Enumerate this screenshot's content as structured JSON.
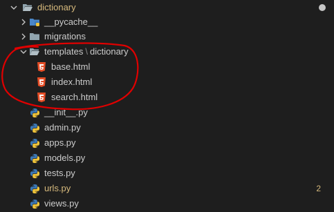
{
  "explorer": {
    "root": {
      "label": "dictionary",
      "icon": "folder-open-icon",
      "expanded": true
    },
    "items": [
      {
        "label": "__pycache__",
        "icon": "folder-python-icon",
        "expanded": false
      },
      {
        "label": "migrations",
        "icon": "folder-icon",
        "expanded": false
      },
      {
        "label_part1": "templates",
        "separator": "\\",
        "label_part2": "dictionary",
        "icon": "folder-open-icon",
        "expanded": true
      },
      {
        "label": "base.html",
        "icon": "html5-icon"
      },
      {
        "label": "index.html",
        "icon": "html5-icon"
      },
      {
        "label": "search.html",
        "icon": "html5-icon"
      },
      {
        "label": "__init__.py",
        "icon": "python-icon"
      },
      {
        "label": "admin.py",
        "icon": "python-icon"
      },
      {
        "label": "apps.py",
        "icon": "python-icon"
      },
      {
        "label": "models.py",
        "icon": "python-icon"
      },
      {
        "label": "tests.py",
        "icon": "python-icon"
      },
      {
        "label": "urls.py",
        "icon": "python-icon",
        "badge": "2"
      },
      {
        "label": "views.py",
        "icon": "python-icon"
      }
    ]
  },
  "colors": {
    "background": "#1e1e1e",
    "text": "#cccccc",
    "modified": "#d7ba7d",
    "html_icon": "#e44d26",
    "annotation": "#e00000"
  }
}
